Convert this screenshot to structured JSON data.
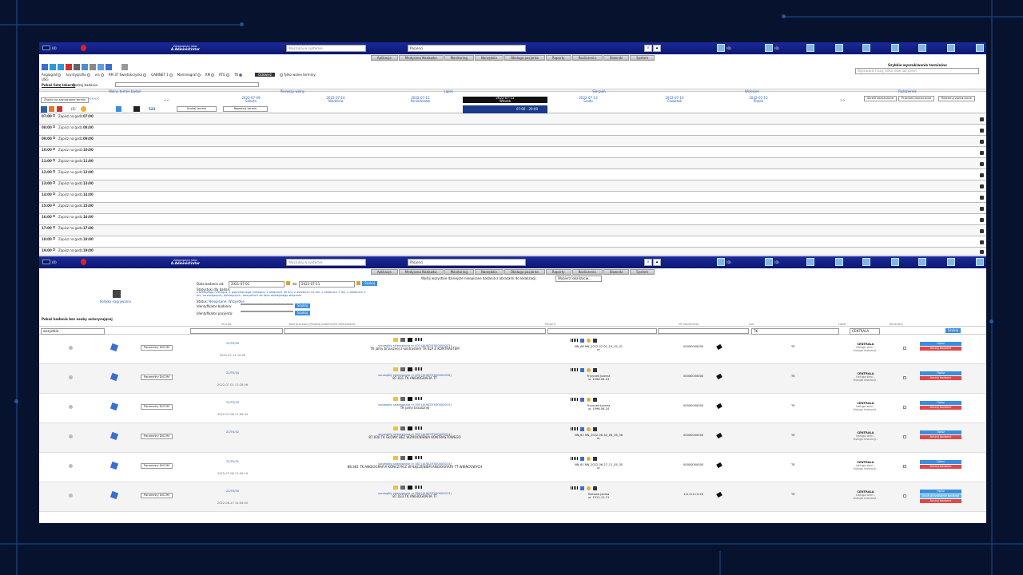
{
  "app": {
    "logged_as_label": "Zalogowany jako:",
    "user": "A.Administrator",
    "count_badge": "(0)",
    "search_placeholder": "Wyszukaj w systemie",
    "search_scope": "Pacjenci",
    "icon_counts": [
      "(0)",
      "(0)"
    ]
  },
  "menu": [
    "Aplikacje",
    "Medyczna Nadawka",
    "Monitoring",
    "Narzędzia",
    "Obsługa pacjenta",
    "Raporty",
    "Rozliczenia",
    "Słowniki",
    "System"
  ],
  "schedule": {
    "quick_search_title": "Szybkie wyszukiwanie terminów:",
    "quick_search_placeholder": "Wprowadź frazę, kilka słów lub pesel",
    "modalities": [
      {
        "label": "Angiograf",
        "on": false
      },
      {
        "label": "Scyntygrafia",
        "on": false
      },
      {
        "label": "vrs",
        "on": false
      },
      {
        "label": "RM 3T Świętokrzyska",
        "on": false
      },
      {
        "label": "GABINET 1",
        "on": false
      },
      {
        "label": "Mammograf",
        "on": false
      },
      {
        "label": "RM",
        "on": false
      },
      {
        "label": "RTG",
        "on": false
      },
      {
        "label": "TK",
        "on": true
      }
    ],
    "usg_label": "USG",
    "refresh_button": "Odśwież",
    "free_only_label": "Tylko wolne terminy",
    "show_list_label": "Pokaż listę lekarzy",
    "exam_type_label": "Rodzaj badania:",
    "columns": [
      "Wolny termin badań",
      "Pierwszy wolny",
      "Lipiec",
      "Sierpień",
      "Wrzesień",
      "Październik"
    ],
    "reserve_button": "Zapisz na zaznaczone termin",
    "nav_prev": "<<<<",
    "nav_prev2": "<<",
    "nav_next2": ">>",
    "nav_next": ">>>>",
    "days": [
      {
        "date": "2022-07-09",
        "day": "Sobota"
      },
      {
        "date": "2022-07-10",
        "day": "Niedziela"
      },
      {
        "date": "2022-07-11",
        "day": "Poniedziałek"
      },
      {
        "date": "2022-07-12",
        "day": "Wtorek",
        "active": true
      },
      {
        "date": "2022-07-13",
        "day": "Środa"
      },
      {
        "date": "2022-07-14",
        "day": "Czwartek"
      },
      {
        "date": "2022-07-15",
        "day": "Piątek"
      }
    ],
    "right_buttons": [
      "Skreśl zaznaczone",
      "Przenieś zaznaczone",
      "Rejestruj zaznaczone"
    ],
    "icon_row_text": "(0)",
    "icon_row_num": "522",
    "find_button": "Szukaj termin",
    "rejestruj_button": "Rejestruj termin",
    "time_range": "07:00 - 20:00",
    "slot_prefix": "Zapisz na godz.",
    "slots": [
      {
        "time": "07:00",
        "label": "07:00"
      },
      {
        "time": "08:00",
        "label": "08:00"
      },
      {
        "time": "09:00",
        "label": "09:00"
      },
      {
        "time": "10:00",
        "label": "10:00"
      },
      {
        "time": "11:00",
        "label": "11:00"
      },
      {
        "time": "12:00",
        "label": "12:00"
      },
      {
        "time": "13:00",
        "label": "13:00"
      },
      {
        "time": "14:00",
        "label": "14:00"
      },
      {
        "time": "15:00",
        "label": "15:00"
      },
      {
        "time": "16:00",
        "label": "16:00"
      },
      {
        "time": "17:00",
        "label": "17:00"
      },
      {
        "time": "18:00",
        "label": "18:00"
      },
      {
        "time": "19:00",
        "label": "19:00"
      }
    ]
  },
  "list": {
    "send_label": "Wyślij wszystkie dzisiejsze nieopisane badania z obrazami do lokalizacji:",
    "send_select": "Wybierz lokalizację...",
    "rec_queue": "Kolejka nagrywania",
    "date_label": "Data badania od:",
    "date_from": "2021-07-01",
    "date_to_label": "do:",
    "date_to": "2022-07-11",
    "find_button": "Szukaj",
    "stats_label": "Statystyki dla badań:",
    "stats_links": "z bieżącego miesiąca, z poprzedniego miesiąca, z ostatnich 30 dni, z ostatnich 14 dni, z ostatnich 7 dni, z ostatnich 3 dni, wczorajszych, dzisiejszych, wszystkich do dnia dzisiejszego włącznie",
    "status_label": "Status:",
    "status_value": "Nieopisane, Wszystkie",
    "exam_id_label": "Identyfikator badania:",
    "patient_id_label": "Identyfikator pacjenta:",
    "show_no_auth": "Pokaż badania bez osoby autoryzującej",
    "headers": [
      "Nr bad.",
      "Kod procedury/Rodzaj badania/Nr skierowania",
      "Pacjent",
      "Nr dokumentu",
      "Lok.",
      "Lokal",
      "Konsultuj"
    ],
    "filter_all": "wszystkie",
    "filter_lab": "TK",
    "filter_loc": "CENTRALA",
    "dicom_btn": "Parametry DICOM",
    "rows": [
      {
        "nr": "22/TK/35",
        "date": "2022-07-11 10:59",
        "ref": "szczegóły skierowania nr 403 [AUKCEF000000023]",
        "proc": "TK jamy brzusznej z kontrastem TK KLP Z KONTRASTEM",
        "patient": "NN_68 NN_2022-07-01_10_42_01",
        "sub": "ur.",
        "doc": "00000000000",
        "lab": "TK",
        "loc": "CENTRALA",
        "btns": [
          "Opisz",
          "Anuluj badanie"
        ]
      },
      {
        "nr": "22/TK/34",
        "date": "2022-07-01 11:28:56",
        "ref": "szczegóły skierowania nr 400 [AUKCEF000000018]",
        "proc": "87.031 TK ANGIOGRAFIA TT",
        "patient": "Fryzczek Joanna",
        "sub": "ur. 1996-06-24",
        "doc": "00000000000",
        "lab": "TK",
        "loc": "CENTRALA",
        "btns": [
          "Opisz",
          "Anuluj badanie"
        ]
      },
      {
        "nr": "22/TK/33",
        "date": "2022-07-08 11:00:44",
        "ref": "szczegóły skierowania nr 395 [AUKCEF000000015]",
        "proc": "TK jamy brzusznej",
        "patient": "Fryzczek Joanna",
        "sub": "ur. 1996-06-24",
        "doc": "00000000000",
        "lab": "TK",
        "loc": "CENTRALA",
        "btns": [
          "Opisz",
          "Anuluj badanie"
        ]
      },
      {
        "nr": "22/TK/32",
        "date": "",
        "ref": "szczegóły skierowania nr 393 [AUKCEF000000014]",
        "proc": "87.030 TK GŁOWY BEZ WZMOCNIENIA KONTRASTOWEGO",
        "patient": "NN_62 NN_2022-06-30_08_36_36",
        "sub": "ur.",
        "doc": "00000000000",
        "lab": "TK",
        "loc": "CENTRALA",
        "btns": [
          "Opisz",
          "Anuluj badanie"
        ]
      },
      {
        "nr": "22/TK/31",
        "date": "2022-07-08 11:00:19",
        "ref": "szczegóły skierowania nr 387 [AUKCEF000000014]",
        "proc": "88.381 TK ANGIOGRAFIA KOŃCZYN Z WYŁĄCZENIEM ANGIOGRAFII TT WIEŃCOWYCH",
        "patient": "NN_61 NN_2022-06-27_11_05_35",
        "sub": "ur.",
        "doc": "00000000000",
        "lab": "TK",
        "loc": "CENTRALA",
        "btns": [
          "Opisz",
          "Anuluj badanie"
        ]
      },
      {
        "nr": "22/TK/30",
        "date": "2022-06-27 14:05:00",
        "ref": "szczegóły skierowania nr 386 [AUKCEF000000013]",
        "proc": "87.033 TK ANGIOGRAFIA TT",
        "patient": "Testowa Janina",
        "sub": "ur. 1911-11-11",
        "doc": "11111111123",
        "lab": "TK",
        "loc": "CENTRALA",
        "btns": [
          "Opisz",
          "Usuń przypisanie badania",
          "Anuluj badanie"
        ]
      }
    ],
    "loc_sub": "Usługa sieci -",
    "loc_sub2": "Usługa instancji -"
  }
}
